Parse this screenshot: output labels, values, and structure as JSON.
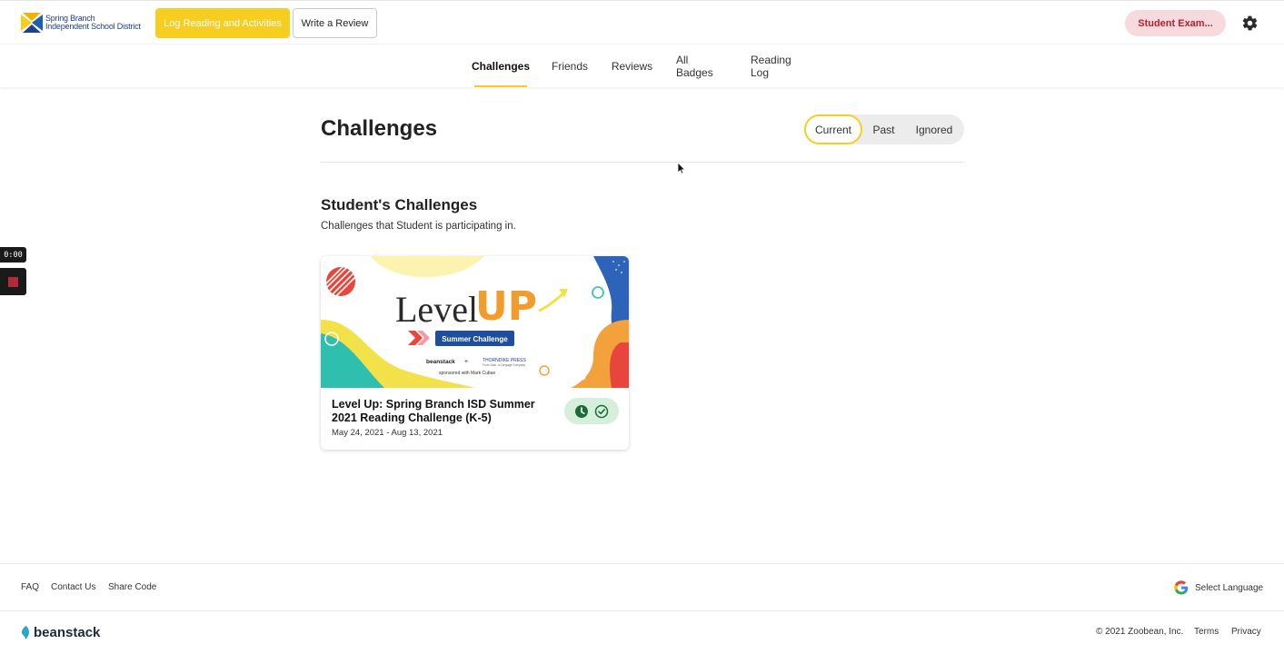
{
  "header": {
    "logo_line1": "Spring Branch",
    "logo_line2": "Independent School District",
    "log_button": "Log Reading and Activities",
    "review_button": "Write a Review",
    "user_button": "Student Exam...",
    "settings_icon": "gear-icon"
  },
  "nav": {
    "tabs": [
      {
        "label": "Challenges",
        "active": true
      },
      {
        "label": "Friends",
        "active": false
      },
      {
        "label": "Reviews",
        "active": false
      },
      {
        "label": "All Badges",
        "active": false
      },
      {
        "label": "Reading Log",
        "active": false
      }
    ]
  },
  "main": {
    "title": "Challenges",
    "filters": [
      {
        "label": "Current",
        "active": true
      },
      {
        "label": "Past",
        "active": false
      },
      {
        "label": "Ignored",
        "active": false
      }
    ],
    "section_title": "Student's Challenges",
    "section_subtitle": "Challenges that Student is participating in."
  },
  "card": {
    "banner": {
      "title_level": "Level",
      "title_up": "UP",
      "tag": "Summer Challenge",
      "partner1": "beanstack",
      "partner2": "THORNDIKE PRESS",
      "partner2_sub": "From Gale, a Cengage Company",
      "sponsor": "sponsored with Mark Cuban"
    },
    "title": "Level Up: Spring Branch ISD Summer 2021 Reading Challenge (K-5)",
    "dates": "May 24, 2021 - Aug 13, 2021",
    "status_icons": [
      "clock-icon",
      "check-circle-icon"
    ]
  },
  "recorder": {
    "time": "0:00"
  },
  "footer": {
    "links": [
      "FAQ",
      "Contact Us",
      "Share Code"
    ],
    "language": "Select Language",
    "brand": "beanstack",
    "copyright": "© 2021 Zoobean, Inc.",
    "terms": "Terms",
    "privacy": "Privacy"
  },
  "colors": {
    "accent_yellow": "#f7ce1f",
    "user_pill_bg": "#f6dadd",
    "user_pill_text": "#b8202f",
    "status_pill_bg": "#d6efdc",
    "status_icon": "#1d6b3a"
  }
}
